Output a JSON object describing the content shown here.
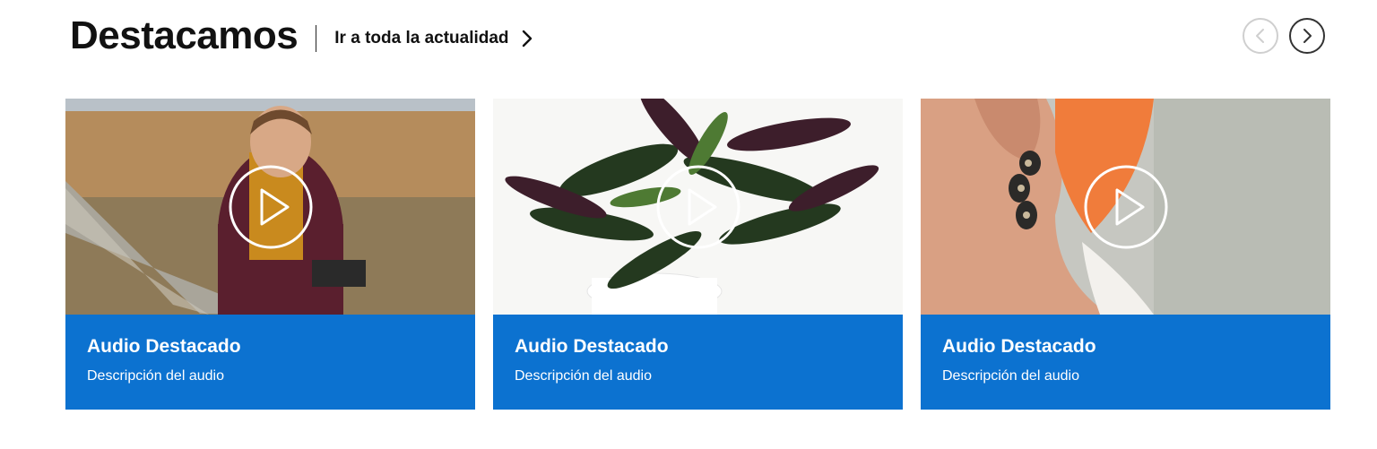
{
  "header": {
    "title": "Destacamos",
    "link_label": "Ir a toda la actualidad"
  },
  "nav": {
    "prev_icon": "chevron-left-icon",
    "next_icon": "chevron-right-icon"
  },
  "cards": [
    {
      "title": "Audio Destacado",
      "description": "Descripción del audio",
      "image": "woman-with-camera-in-field"
    },
    {
      "title": "Audio Destacado",
      "description": "Descripción del audio",
      "image": "potted-plant"
    },
    {
      "title": "Audio Destacado",
      "description": "Descripción del audio",
      "image": "woman-earring-closeup"
    }
  ],
  "colors": {
    "card_background": "#0c72d0",
    "text": "#111111"
  }
}
